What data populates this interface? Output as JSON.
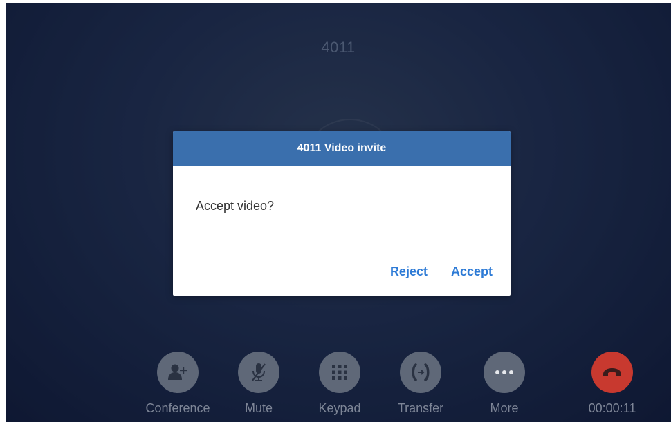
{
  "call": {
    "caller_number": "4011",
    "duration": "00:00:11"
  },
  "dialog": {
    "title": "4011 Video invite",
    "message": "Accept video?",
    "reject_label": "Reject",
    "accept_label": "Accept"
  },
  "controls": {
    "conference": {
      "label": "Conference",
      "icon": "add-person-icon"
    },
    "mute": {
      "label": "Mute",
      "icon": "microphone-muted-icon"
    },
    "keypad": {
      "label": "Keypad",
      "icon": "keypad-grid-icon"
    },
    "transfer": {
      "label": "Transfer",
      "icon": "call-transfer-icon"
    },
    "more": {
      "label": "More",
      "icon": "more-dots-icon"
    },
    "end_call": {
      "icon": "hang-up-icon"
    }
  },
  "colors": {
    "dialog_header": "#3a6fad",
    "action_text": "#2e7bd6",
    "hangup": "#c8392f",
    "control_circle": "#5f6878"
  }
}
